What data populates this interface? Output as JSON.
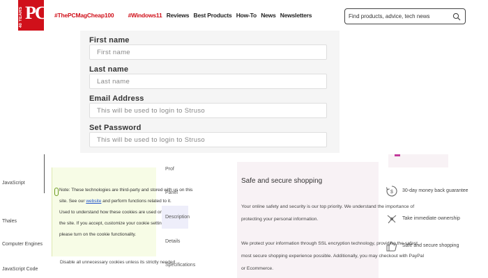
{
  "header": {
    "logo_years": "40 YEARS",
    "logo_text": "PC",
    "nav": [
      {
        "label": "#ThePCMagCheap100",
        "tag": true
      },
      {
        "label": "#Windows11",
        "tag": true
      },
      {
        "label": "Reviews",
        "tag": false
      },
      {
        "label": "Best Products",
        "tag": false
      },
      {
        "label": "How-To",
        "tag": false
      },
      {
        "label": "News",
        "tag": false
      },
      {
        "label": "Newsletters",
        "tag": false
      }
    ],
    "search_placeholder": "Find products, advice, tech news",
    "search_icon": "search-icon"
  },
  "form": {
    "first_name_label": "First name",
    "first_name_placeholder": "First name",
    "last_name_label": "Last name",
    "last_name_placeholder": "Last name",
    "email_label": "Email Address",
    "email_placeholder": "This will be used to login to Struso",
    "password_label": "Set Password",
    "password_placeholder": "This will be used to login to Struso"
  },
  "left_sidebar": {
    "items": [
      "JavaScript",
      "Thales",
      "Computer Engines",
      "JavaScript Code"
    ]
  },
  "notice": {
    "lines": [
      "Note: These technologies are third-party and stored with us on this",
      "site. See our ",
      "Used to understand how these cookies are used on",
      "the site. If you accept, customize your cookie settings,",
      "please turn on the cookie functionality."
    ],
    "link": "website",
    "line2_tail": " and perform functions related to it.",
    "after": "Disable all unnecessary cookies unless its strictly needed"
  },
  "middle_menu": {
    "items": [
      "Prof",
      "Panel",
      "Description",
      "Details",
      "Specifications"
    ]
  },
  "safe_shopping": {
    "heading": "Safe and secure shopping",
    "para1": [
      "Your online safety and security is our top priority. We understand the importance of",
      "protecting your personal information."
    ],
    "para2": [
      "We protect your information through SSL encryption technology, providing the safest,",
      "most secure shopping experience possible. Additionally, you may checkout with PayPal",
      "or Ecommerce."
    ]
  },
  "features": [
    {
      "icon": "money-back-icon",
      "label": "30-day money back guarantee"
    },
    {
      "icon": "ownership-icon",
      "label": "Take immediate ownership"
    },
    {
      "icon": "thumbs-up-icon",
      "label": "Safe and secure shopping"
    }
  ],
  "colors": {
    "brand_red": "#d0101a",
    "tag_red": "#d0101a",
    "notice_bg": "#f7fce6",
    "panel_pink": "#f8f2f5",
    "accent_magenta": "#c33a9b"
  }
}
